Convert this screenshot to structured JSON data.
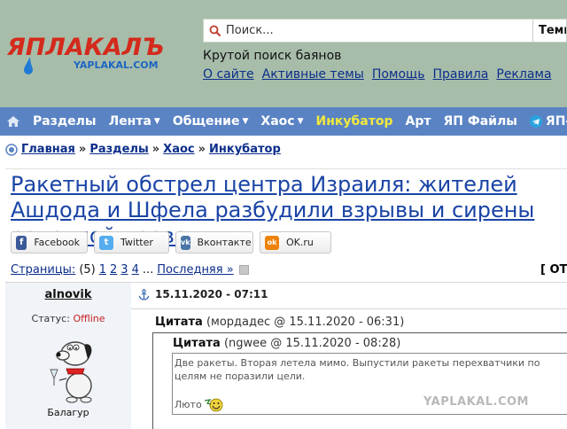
{
  "header": {
    "logo_text": "ЯПЛАКАЛЪ",
    "logo_sub": "YAPLAKAL.COM",
    "search_placeholder": "Поиск...",
    "search_scope": "Темы",
    "tagline": "Крутой поиск баянов",
    "links": [
      "О сайте",
      "Активные темы",
      "Помощь",
      "Правила",
      "Реклама"
    ]
  },
  "nav": {
    "items": [
      {
        "label": "Разделы",
        "caret": ""
      },
      {
        "label": "Лента",
        "caret": "▼"
      },
      {
        "label": "Общение",
        "caret": "▼"
      },
      {
        "label": "Хаос",
        "caret": "▼"
      },
      {
        "label": "Инкубатор",
        "caret": ""
      },
      {
        "label": "Арт",
        "caret": ""
      },
      {
        "label": "ЯП Файлы",
        "caret": ""
      }
    ],
    "telegram_label": "ЯП-Т"
  },
  "breadcrumb": {
    "items": [
      "Главная",
      "Разделы",
      "Хаос",
      "Инкубатор"
    ],
    "separator": "»"
  },
  "topic": {
    "title": "Ракетный обстрел центра Израиля: жителей Ашдода и Шфела разбудили взрывы и сирены ракетной тревоги"
  },
  "share": {
    "buttons": [
      {
        "label": "Facebook",
        "icon": "facebook-icon",
        "icon_text": "f",
        "color": "#3b5998"
      },
      {
        "label": "Twitter",
        "icon": "twitter-icon",
        "icon_text": "t",
        "color": "#55acee"
      },
      {
        "label": "Вконтакте",
        "icon": "vk-icon",
        "icon_text": "vk",
        "color": "#4a76a8"
      },
      {
        "label": "OK.ru",
        "icon": "odnoklassniki-icon",
        "icon_text": "ok",
        "color": "#ee8208"
      }
    ]
  },
  "pagination": {
    "label": "Страницы:",
    "count": "(5)",
    "pages": [
      "1",
      "2",
      "3",
      "4"
    ],
    "ellipsis": "...",
    "last_label": "Последняя »",
    "reply_cut": "[ ОТ"
  },
  "post": {
    "author": "alnovik",
    "status_label": "Статус:",
    "status_value": "Offline",
    "rank": "Балагур",
    "date": "15.11.2020 - 07:11",
    "quote_outer_label": "Цитата",
    "quote_outer_meta": "(мордадес @ 15.11.2020 - 06:31)",
    "quote_inner_label": "Цитата",
    "quote_inner_meta": "(ngwee @ 15.11.2020 - 08:28)",
    "quote_text": "Две ракеты. Вторая летела мимо. Выпустили ракеты перехватчики по целям не поразили цели.",
    "quote_signature": "Люто"
  },
  "watermark": "YAPLAKAL.COM",
  "colors": {
    "header_bg": "#a7bdaa",
    "nav_bg": "#5a83c4",
    "nav_highlight": "#f2e93d",
    "link": "#0b2e8a",
    "title": "#1a44a6",
    "logo_red": "#d42a1c"
  }
}
